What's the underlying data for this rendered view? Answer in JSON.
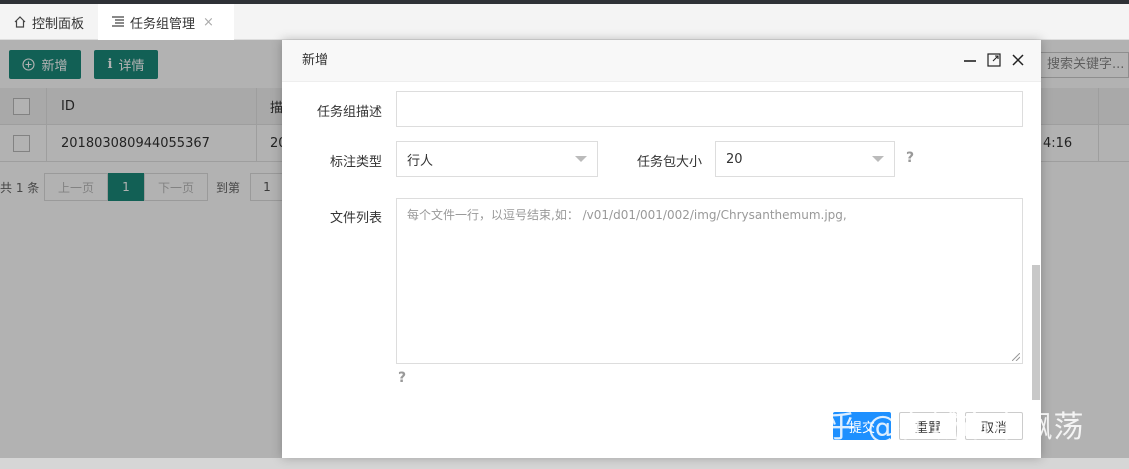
{
  "tabs": [
    {
      "label": "控制面板",
      "icon": "home-icon"
    },
    {
      "label": "任务组管理",
      "icon": "list-icon",
      "close": "×"
    }
  ],
  "toolbar": {
    "add_label": "新增",
    "detail_label": "详情"
  },
  "search": {
    "placeholder": "搜索关键字..."
  },
  "grid": {
    "columns": [
      "ID",
      "描"
    ],
    "rows": [
      {
        "id": "201803080944055367",
        "col2": "20",
        "time": "4:16"
      }
    ]
  },
  "pager": {
    "total": "共 1 条",
    "prev": "上一页",
    "current": "1",
    "next": "下一页",
    "goto_label": "到第",
    "goto_value": "1"
  },
  "dialog": {
    "title": "新增",
    "fields": {
      "desc_label": "任务组描述",
      "desc_value": "",
      "type_label": "标注类型",
      "type_value": "行人",
      "size_label": "任务包大小",
      "size_value": "20",
      "files_label": "文件列表",
      "files_placeholder": "每个文件一行，以逗号结束,如： /v01/d01/001/002/img/Chrysanthemum.jpg,"
    },
    "help": "?",
    "buttons": {
      "submit": "提交",
      "reset": "重置",
      "cancel": "取消"
    }
  },
  "watermark": "知乎 @在城市中飘荡",
  "colors": {
    "accent": "#1a8a7a",
    "submit": "#1e90ff"
  }
}
